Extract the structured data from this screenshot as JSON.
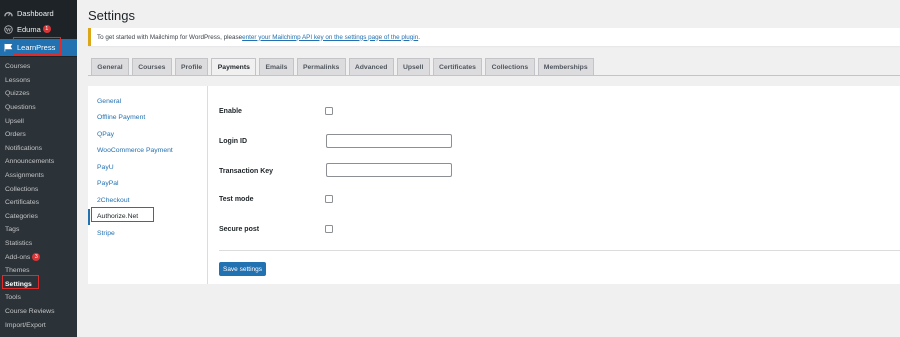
{
  "sidebar": {
    "top": [
      {
        "label": "Dashboard",
        "icon": "dashboard-icon"
      },
      {
        "label": "Eduma",
        "icon": "wordpress-icon",
        "badge": "1"
      },
      {
        "label": "LearnPress",
        "icon": "flag-icon"
      }
    ],
    "submenu": [
      {
        "label": "Courses"
      },
      {
        "label": "Lessons"
      },
      {
        "label": "Quizzes"
      },
      {
        "label": "Questions"
      },
      {
        "label": "Upsell"
      },
      {
        "label": "Orders"
      },
      {
        "label": "Notifications"
      },
      {
        "label": "Announcements"
      },
      {
        "label": "Assignments"
      },
      {
        "label": "Collections"
      },
      {
        "label": "Certificates"
      },
      {
        "label": "Categories"
      },
      {
        "label": "Tags"
      },
      {
        "label": "Statistics"
      },
      {
        "label": "Add-ons",
        "badge": "3"
      },
      {
        "label": "Themes"
      },
      {
        "label": "Settings",
        "current": true
      },
      {
        "label": "Tools"
      },
      {
        "label": "Course Reviews"
      },
      {
        "label": "Import/Export"
      }
    ]
  },
  "page": {
    "title": "Settings"
  },
  "notice": {
    "text_before": "To get started with Mailchimp for WordPress, please ",
    "link_text": "enter your Mailchimp API key on the settings page of the plugin",
    "text_after": "."
  },
  "tabs": [
    {
      "label": "General"
    },
    {
      "label": "Courses"
    },
    {
      "label": "Profile"
    },
    {
      "label": "Payments",
      "active": true
    },
    {
      "label": "Emails"
    },
    {
      "label": "Permalinks"
    },
    {
      "label": "Advanced"
    },
    {
      "label": "Upsell"
    },
    {
      "label": "Certificates"
    },
    {
      "label": "Collections"
    },
    {
      "label": "Memberships"
    }
  ],
  "payment_methods": [
    {
      "label": "General"
    },
    {
      "label": "Offline Payment"
    },
    {
      "label": "QPay"
    },
    {
      "label": "WooCommerce Payment"
    },
    {
      "label": "PayU"
    },
    {
      "label": "PayPal"
    },
    {
      "label": "2Checkout"
    },
    {
      "label": "Authorize.Net",
      "active": true
    },
    {
      "label": "Stripe"
    }
  ],
  "form": {
    "enable_label": "Enable",
    "enable_checked": false,
    "login_id_label": "Login ID",
    "login_id_value": "",
    "transaction_key_label": "Transaction Key",
    "transaction_key_value": "",
    "test_mode_label": "Test mode",
    "test_mode_checked": false,
    "secure_post_label": "Secure post",
    "secure_post_checked": false,
    "save_label": "Save settings"
  },
  "colors": {
    "accent": "#2271b1",
    "highlight_box": "#e02b2b",
    "sidebar_bg": "#1d2327",
    "badge": "#d63638",
    "notice_border": "#dba617"
  }
}
